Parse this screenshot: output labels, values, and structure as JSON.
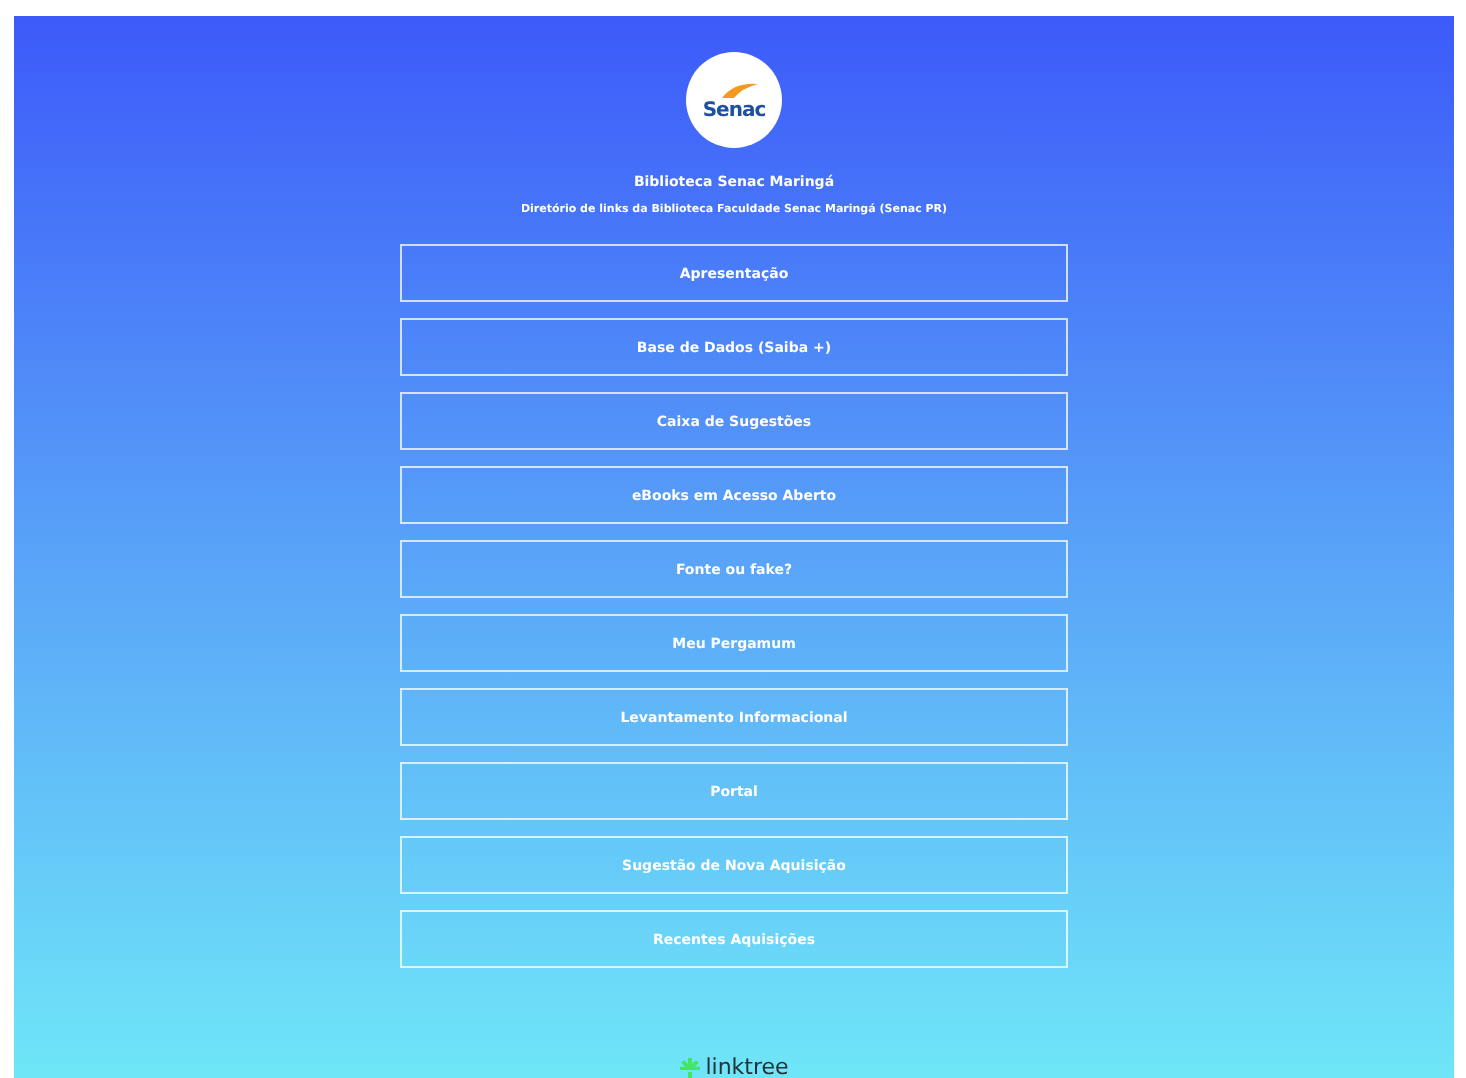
{
  "profile": {
    "logo_text": "Senac",
    "title": "Biblioteca Senac Maringá",
    "description": "Diretório de links da Biblioteca Faculdade Senac Maringá (Senac PR)"
  },
  "links": [
    {
      "label": "Apresentação"
    },
    {
      "label": "Base de Dados (Saiba +)"
    },
    {
      "label": "Caixa de Sugestões"
    },
    {
      "label": "eBooks em Acesso Aberto"
    },
    {
      "label": "Fonte ou fake?"
    },
    {
      "label": "Meu Pergamum"
    },
    {
      "label": "Levantamento Informacional"
    },
    {
      "label": "Portal"
    },
    {
      "label": "Sugestão de Nova Aquisição"
    },
    {
      "label": "Recentes Aquisições"
    }
  ],
  "footer": {
    "brand": "linktree"
  }
}
